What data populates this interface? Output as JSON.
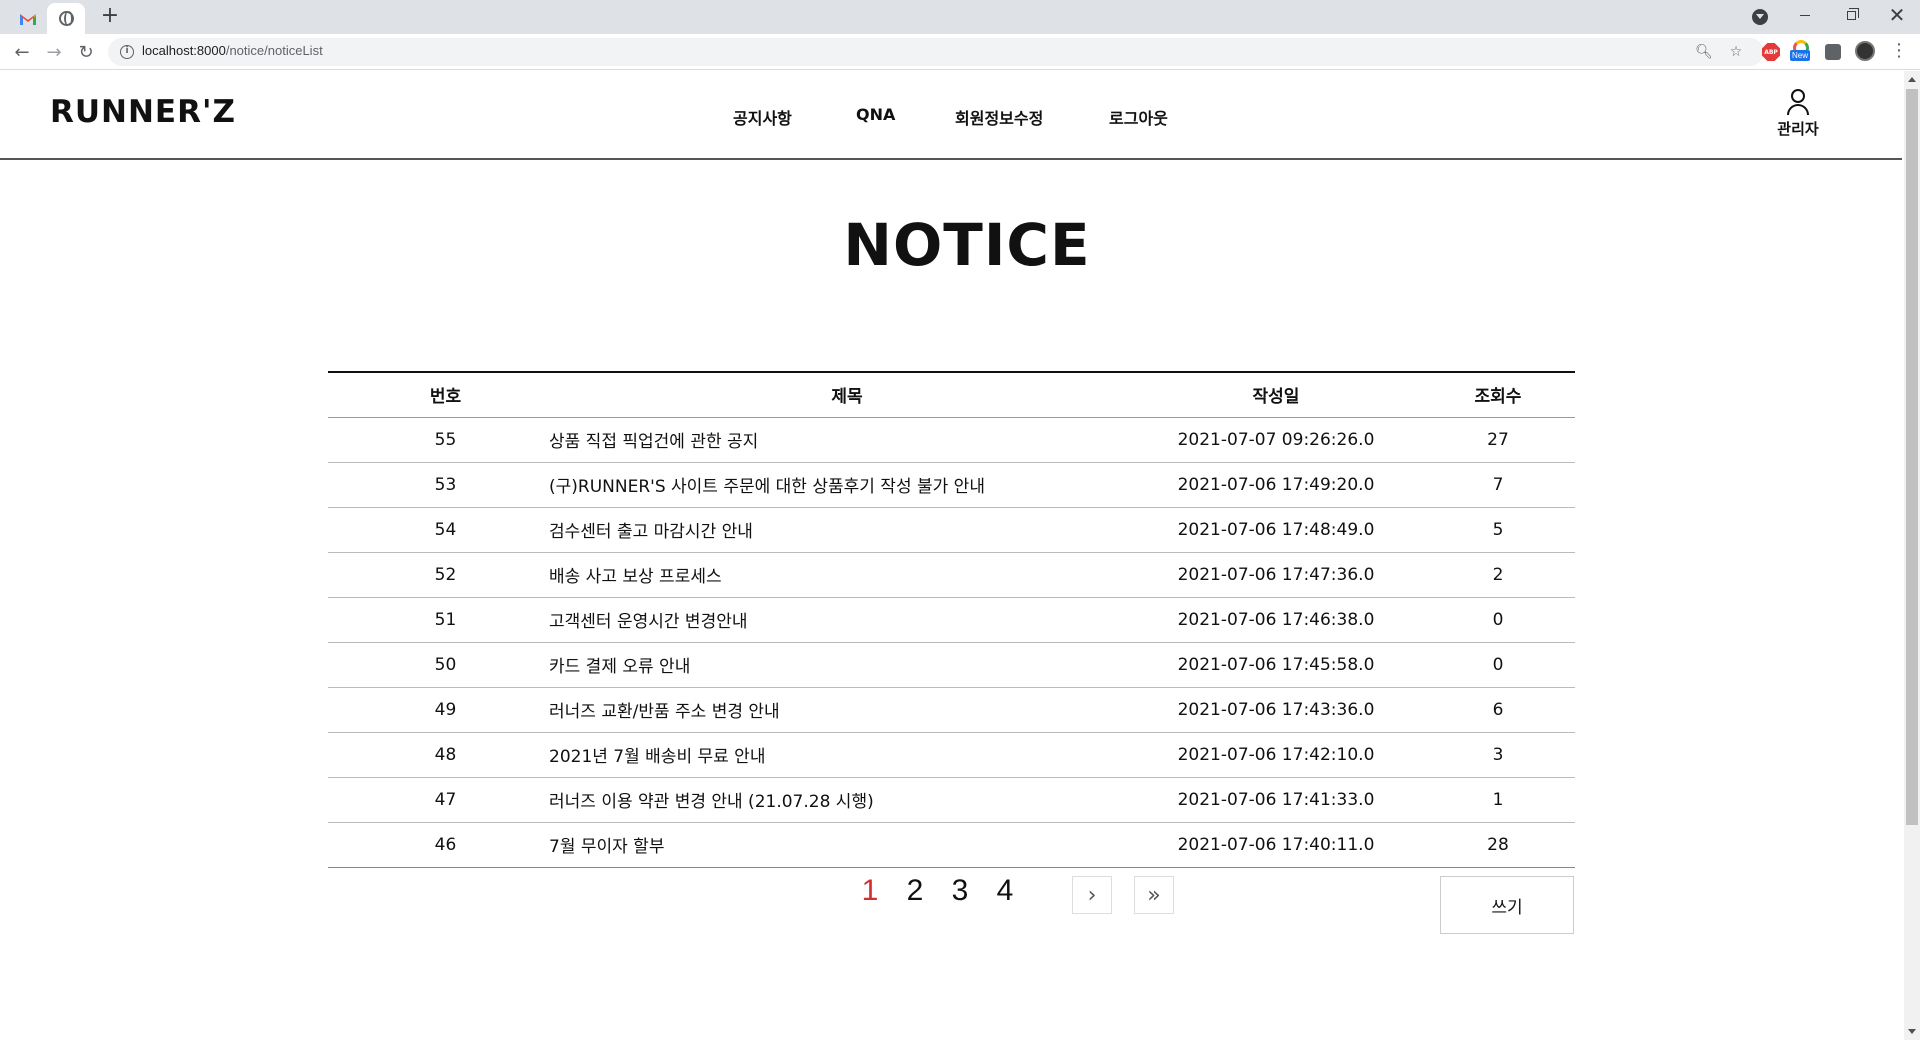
{
  "browser": {
    "tabs": [
      {
        "icon": "gmail-icon"
      },
      {
        "icon": "globe-icon",
        "active": true
      }
    ],
    "new_tab": "+",
    "url_host": "localhost:8000",
    "url_path": "/notice/noticeList",
    "extensions": {
      "abp": "ABP",
      "new_badge": "New"
    }
  },
  "site": {
    "logo": "RUNNER'Z",
    "nav": [
      "공지사항",
      "QNA",
      "회원정보수정",
      "로그아웃"
    ],
    "user_label": "관리자"
  },
  "page_title": "NOTICE",
  "table": {
    "headers": [
      "번호",
      "제목",
      "작성일",
      "조회수"
    ],
    "rows": [
      {
        "no": "55",
        "title": "상품 직접 픽업건에 관한 공지",
        "date": "2021-07-07 09:26:26.0",
        "views": "27"
      },
      {
        "no": "53",
        "title": "(구)RUNNER'S 사이트 주문에 대한 상품후기 작성 불가 안내",
        "date": "2021-07-06 17:49:20.0",
        "views": "7"
      },
      {
        "no": "54",
        "title": "검수센터 출고 마감시간 안내",
        "date": "2021-07-06 17:48:49.0",
        "views": "5"
      },
      {
        "no": "52",
        "title": "배송 사고 보상 프로세스",
        "date": "2021-07-06 17:47:36.0",
        "views": "2"
      },
      {
        "no": "51",
        "title": "고객센터 운영시간 변경안내",
        "date": "2021-07-06 17:46:38.0",
        "views": "0"
      },
      {
        "no": "50",
        "title": "카드 결제 오류 안내",
        "date": "2021-07-06 17:45:58.0",
        "views": "0"
      },
      {
        "no": "49",
        "title": "러너즈 교환/반품 주소 변경 안내",
        "date": "2021-07-06 17:43:36.0",
        "views": "6"
      },
      {
        "no": "48",
        "title": "2021년 7월 배송비 무료 안내",
        "date": "2021-07-06 17:42:10.0",
        "views": "3"
      },
      {
        "no": "47",
        "title": "러너즈 이용 약관 변경 안내 (21.07.28 시행)",
        "date": "2021-07-06 17:41:33.0",
        "views": "1"
      },
      {
        "no": "46",
        "title": "7월 무이자 할부",
        "date": "2021-07-06 17:40:11.0",
        "views": "28"
      }
    ]
  },
  "pagination": {
    "pages": [
      "1",
      "2",
      "3",
      "4"
    ],
    "current": "1",
    "next": "›",
    "last": "»"
  },
  "write_button": "쓰기",
  "colors": {
    "active_page": "#d32f2f",
    "header_border": "#555555",
    "tabbar_bg": "#dee1e6"
  }
}
